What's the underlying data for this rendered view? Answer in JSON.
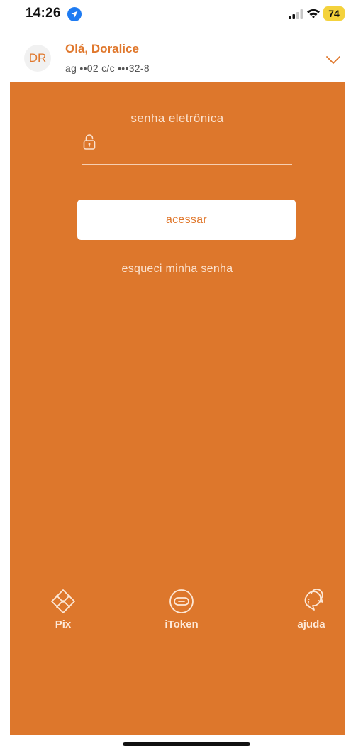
{
  "status_bar": {
    "time": "14:26",
    "battery": "74",
    "battery_color": "#f4d23c"
  },
  "account": {
    "avatar_initials": "DR",
    "greeting": "Olá, Doralice",
    "details": "ag ••02  c/c •••32-8"
  },
  "login": {
    "password_label": "senha eletrônica",
    "password_value": "",
    "access_button": "acessar",
    "forgot_link": "esqueci minha senha"
  },
  "bottom_nav": {
    "pix": "Pix",
    "itoken": "iToken",
    "help": "ajuda"
  },
  "icons": [
    "location-arrow-icon",
    "signal-icon",
    "wifi-icon",
    "chevron-down-icon",
    "lock-icon",
    "pix-icon",
    "token-icon",
    "chat-help-icon"
  ],
  "colors": {
    "brand_orange": "#dd772c",
    "accent_text": "#e0782d",
    "panel_text": "#fbe2cf"
  }
}
